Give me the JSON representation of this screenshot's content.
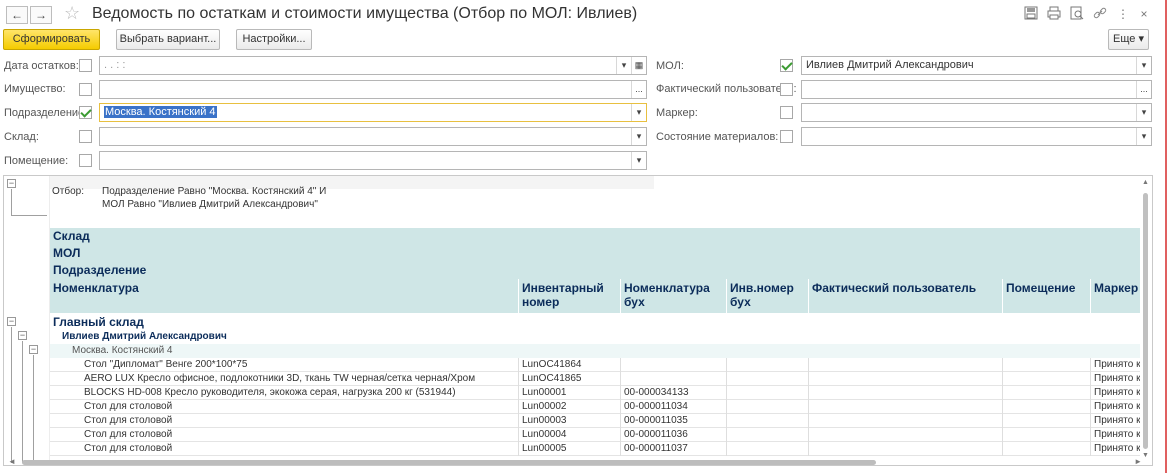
{
  "window": {
    "title": "Ведомость по остаткам и стоимости имущества  (Отбор по МОЛ: Ивлиев)",
    "icons": [
      "back-arrow-icon",
      "forward-arrow-icon",
      "star-icon",
      "save-icon",
      "print-icon",
      "preview-icon",
      "link-icon",
      "more-vertical-icon",
      "close-icon"
    ],
    "back_glyph": "←",
    "forward_glyph": "→",
    "star_glyph": "☆",
    "more_glyph": "⋮",
    "close_glyph": "×"
  },
  "toolbar": {
    "generate_label": "Сформировать",
    "choose_variant_label": "Выбрать вариант...",
    "settings_label": "Настройки...",
    "more_label": "Еще ▾"
  },
  "form": {
    "left": [
      {
        "label": "Дата остатков:",
        "checked": false,
        "value": ".  .      :  :",
        "buttons": [
          "dropdown",
          "calendar"
        ]
      },
      {
        "label": "Имущество:",
        "checked": false,
        "value": "",
        "buttons": [
          "ellipsis"
        ]
      },
      {
        "label": "Подразделение:",
        "checked": true,
        "value": "Москва. Костянский 4",
        "buttons": [
          "dropdown"
        ]
      },
      {
        "label": "Склад:",
        "checked": false,
        "value": "",
        "buttons": [
          "dropdown"
        ]
      },
      {
        "label": "Помещение:",
        "checked": false,
        "value": "",
        "buttons": [
          "dropdown"
        ]
      }
    ],
    "right": [
      {
        "label": "МОЛ:",
        "checked": true,
        "value": "Ивлиев Дмитрий Александрович",
        "buttons": [
          "dropdown"
        ]
      },
      {
        "label": "Фактический пользователь:",
        "checked": false,
        "value": "",
        "buttons": [
          "ellipsis"
        ]
      },
      {
        "label": "Маркер:",
        "checked": false,
        "value": "",
        "buttons": [
          "dropdown"
        ]
      },
      {
        "label": "Состояние материалов:",
        "checked": false,
        "value": "",
        "buttons": [
          "dropdown"
        ]
      }
    ],
    "dropdown_glyph": "▾",
    "ellipsis_glyph": "...",
    "calendar_glyph": "▦"
  },
  "report": {
    "filter_key": "Отбор:",
    "filter_line1": "Подразделение Равно \"Москва. Костянский 4\" И",
    "filter_line2": "МОЛ Равно \"Ивлиев Дмитрий Александрович\"",
    "group_headers": [
      "Склад",
      "МОЛ",
      "Подразделение"
    ],
    "columns": [
      "Номенклатура",
      "Инвентарный номер",
      "Номенклатура бух",
      "Инв.номер бух",
      "Фактический пользователь",
      "Помещение",
      "Маркер"
    ],
    "group_warehouse": "Главный склад",
    "group_mol": "Ивлиев Дмитрий Александрович",
    "group_dept": "Москва. Костянский 4",
    "rows": [
      {
        "name": "Стол \"Дипломат\" Венге 200*100*75",
        "inv": "LunOC41864",
        "nom_buh": "",
        "inv_buh": "",
        "user": "",
        "room": "",
        "marker": "Принято к"
      },
      {
        "name": "AERO LUX Кресло офисное, подлокотники 3D, ткань TW черная/сетка черная/Хром",
        "inv": "LunOC41865",
        "nom_buh": "",
        "inv_buh": "",
        "user": "",
        "room": "",
        "marker": "Принято к"
      },
      {
        "name": "BLOCKS HD-008 Кресло руководителя, экокожа серая, нагрузка 200  кг (531944)",
        "inv": "Lun00001",
        "nom_buh": "00-000034133",
        "inv_buh": "",
        "user": "",
        "room": "",
        "marker": "Принято к"
      },
      {
        "name": "Стол для столовой",
        "inv": "Lun00002",
        "nom_buh": "00-000011034",
        "inv_buh": "",
        "user": "",
        "room": "",
        "marker": "Принято к"
      },
      {
        "name": "Стол для столовой",
        "inv": "Lun00003",
        "nom_buh": "00-000011035",
        "inv_buh": "",
        "user": "",
        "room": "",
        "marker": "Принято к"
      },
      {
        "name": "Стол для столовой",
        "inv": "Lun00004",
        "nom_buh": "00-000011036",
        "inv_buh": "",
        "user": "",
        "room": "",
        "marker": "Принято к"
      },
      {
        "name": "Стол для столовой",
        "inv": "Lun00005",
        "nom_buh": "00-000011037",
        "inv_buh": "",
        "user": "",
        "room": "",
        "marker": "Принято к"
      }
    ]
  }
}
